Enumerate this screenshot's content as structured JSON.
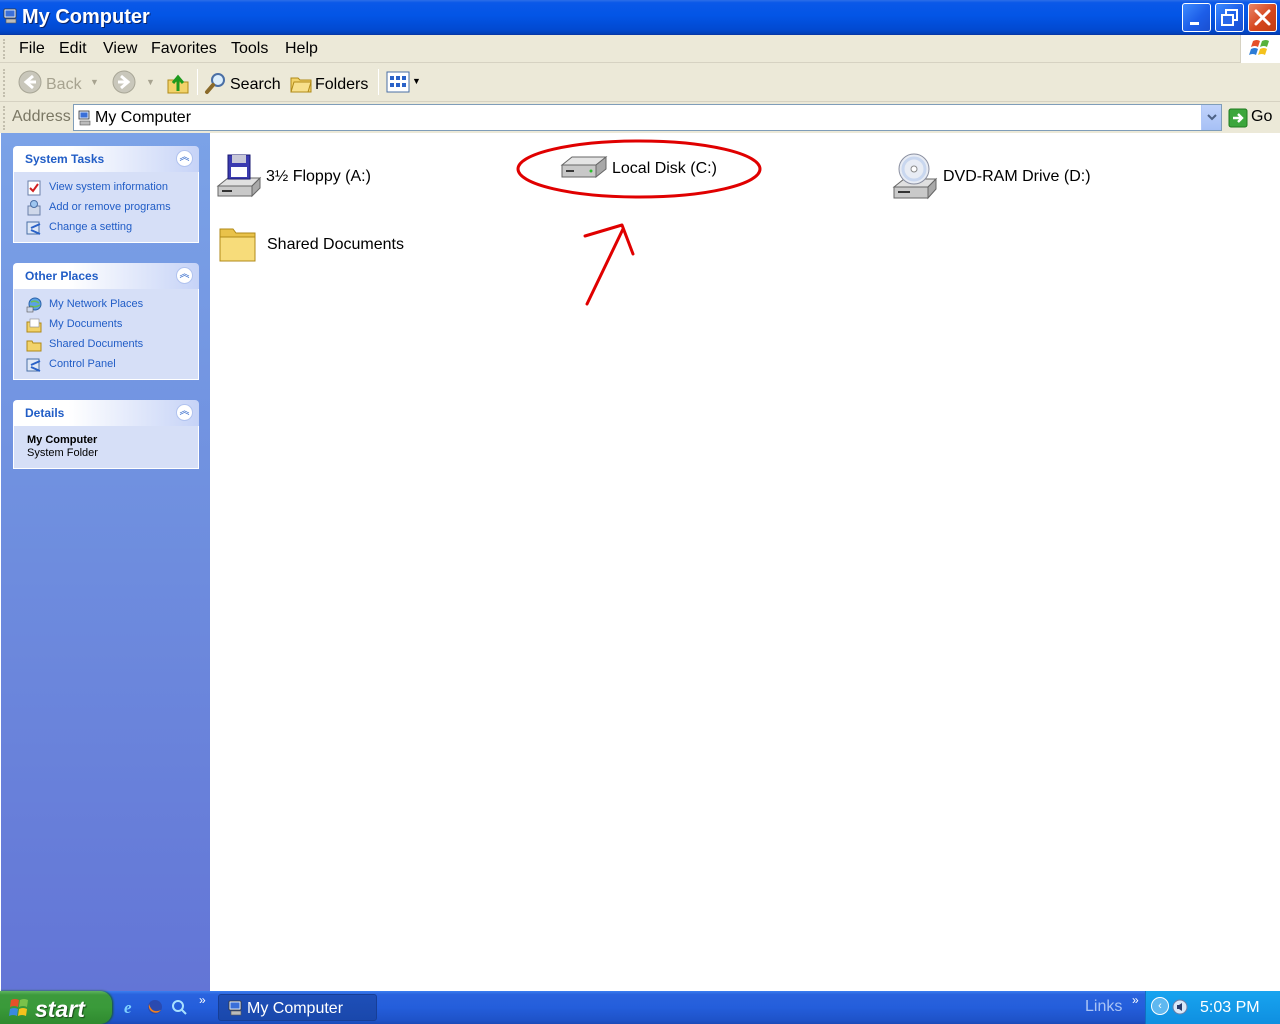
{
  "window": {
    "title": "My Computer"
  },
  "menu": {
    "file": "File",
    "edit": "Edit",
    "view": "View",
    "favorites": "Favorites",
    "tools": "Tools",
    "help": "Help"
  },
  "toolbar": {
    "back": "Back",
    "search": "Search",
    "folders": "Folders"
  },
  "address": {
    "label": "Address",
    "value": "My Computer",
    "go": "Go"
  },
  "taskpane": {
    "system_tasks": {
      "title": "System Tasks",
      "items": [
        {
          "label": "View system information",
          "icon": "system-info-icon"
        },
        {
          "label": "Add or remove programs",
          "icon": "add-remove-icon"
        },
        {
          "label": "Change a setting",
          "icon": "control-panel-icon"
        }
      ]
    },
    "other_places": {
      "title": "Other Places",
      "items": [
        {
          "label": "My Network Places",
          "icon": "network-icon"
        },
        {
          "label": "My Documents",
          "icon": "documents-icon"
        },
        {
          "label": "Shared Documents",
          "icon": "folder-icon"
        },
        {
          "label": "Control Panel",
          "icon": "control-panel-icon"
        }
      ]
    },
    "details": {
      "title": "Details",
      "name": "My Computer",
      "type": "System Folder"
    }
  },
  "content": {
    "items": [
      {
        "label": "3½ Floppy (A:)",
        "icon": "floppy-drive-icon"
      },
      {
        "label": "Local Disk (C:)",
        "icon": "hard-disk-icon"
      },
      {
        "label": "DVD-RAM Drive (D:)",
        "icon": "dvd-drive-icon"
      },
      {
        "label": "Shared Documents",
        "icon": "folder-icon"
      }
    ],
    "annotation_color": "#e00000"
  },
  "taskbar": {
    "start": "start",
    "window_button": "My Computer",
    "links": "Links",
    "clock": "5:03 PM"
  },
  "colors": {
    "titlebar": "#0355e6",
    "taskpane": "#6f8fdf",
    "taskpane_link": "#215dc6",
    "start_button": "#3a9a3a"
  }
}
